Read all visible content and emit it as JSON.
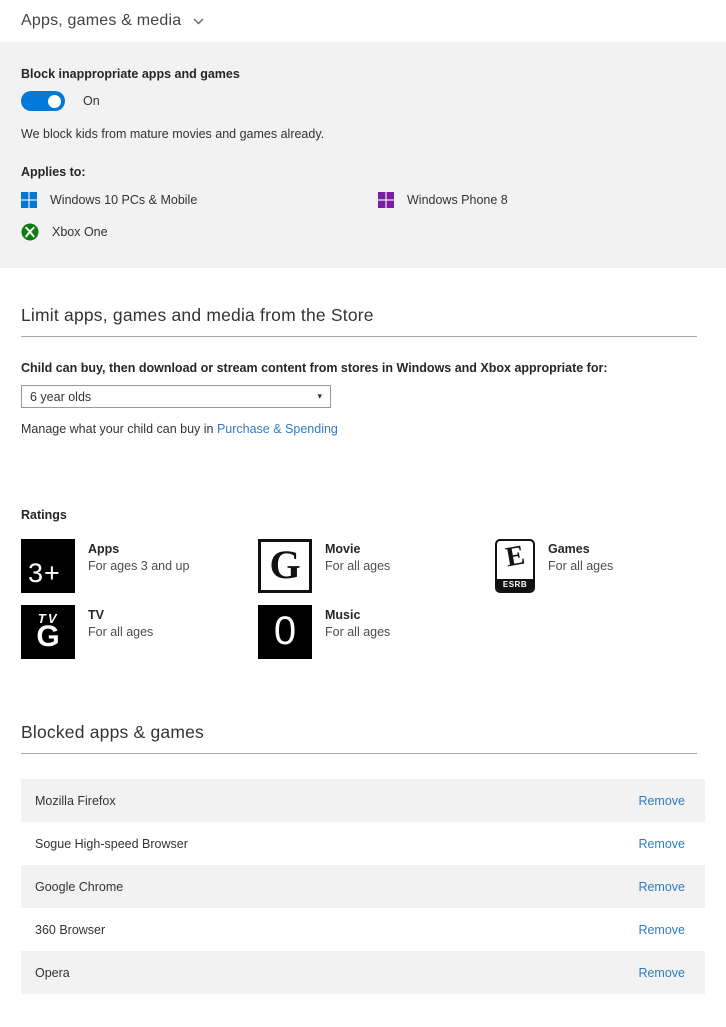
{
  "header": {
    "title": "Apps, games & media"
  },
  "block": {
    "label": "Block inappropriate apps and games",
    "toggle_state": "On",
    "toggle_on": true,
    "description": "We block kids from mature movies and games already.",
    "applies_to_label": "Applies to:",
    "devices": [
      {
        "label": "Windows 10 PCs & Mobile",
        "icon": "windows-logo",
        "color": "#0078d7"
      },
      {
        "label": "Windows Phone 8",
        "icon": "windows-logo",
        "color": "#7a1fa2"
      },
      {
        "label": "Xbox One",
        "icon": "xbox-logo",
        "color": "#107c10"
      }
    ]
  },
  "limit": {
    "heading": "Limit apps, games and media from the Store",
    "prompt": "Child can buy, then download or stream content from stores in Windows and Xbox appropriate for:",
    "dropdown_value": "6 year olds",
    "dropdown_arrow": "▾",
    "manage_text": "Manage what your child can buy in ",
    "manage_link": "Purchase & Spending"
  },
  "ratings": {
    "label": "Ratings",
    "items": [
      {
        "category": "Apps",
        "desc": "For ages 3 and up",
        "badge_type": "apps",
        "badge_text": "3+"
      },
      {
        "category": "Movie",
        "desc": "For all ages",
        "badge_type": "movie",
        "badge_text": "G"
      },
      {
        "category": "Games",
        "desc": "For all ages",
        "badge_type": "games",
        "badge_text": "E",
        "badge_sub": "ESRB"
      },
      {
        "category": "TV",
        "desc": "For all ages",
        "badge_type": "tv",
        "badge_top": "TV",
        "badge_text": "G"
      },
      {
        "category": "Music",
        "desc": "For all ages",
        "badge_type": "music",
        "badge_text": "0"
      }
    ]
  },
  "blocked": {
    "heading": "Blocked apps & games",
    "remove_label": "Remove",
    "apps": [
      {
        "name": "Mozilla Firefox"
      },
      {
        "name": "Sogue High-speed Browser"
      },
      {
        "name": "Google Chrome"
      },
      {
        "name": "360 Browser"
      },
      {
        "name": "Opera"
      }
    ]
  },
  "colors": {
    "accent": "#0078d7",
    "link": "#2f7cc3",
    "panel_bg": "#f2f2f2"
  }
}
